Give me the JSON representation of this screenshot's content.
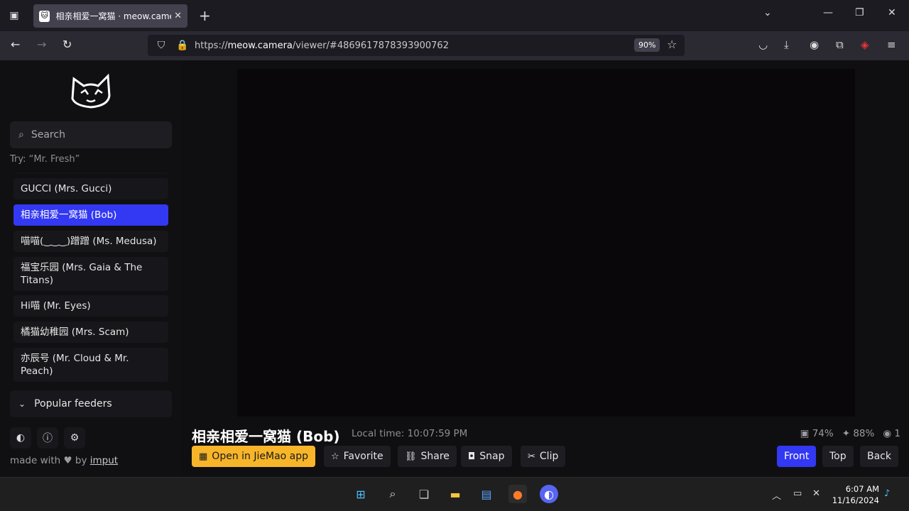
{
  "browser": {
    "tab_title": "相亲相爱一窝猫 · meow.camera",
    "url_prefix": "https://",
    "url_domain": "meow.camera",
    "url_path": "/viewer/#4869617878393900762",
    "zoom": "90%"
  },
  "sidebar": {
    "search_placeholder": "Search",
    "hint": "Try: “Mr. Fresh”",
    "cameras": [
      {
        "label": "GUCCI (Mrs. Gucci)"
      },
      {
        "label": "相亲相爱一窝猫 (Bob)",
        "active": true
      },
      {
        "label": "喵喵(‿‿‿)蹭蹭 (Ms. Medusa)"
      },
      {
        "label": "福宝乐园 (Mrs. Gaia & The Titans)"
      },
      {
        "label": "Hi喵 (Mr. Eyes)"
      },
      {
        "label": "橘猫幼稚园 (Mrs. Scam)"
      },
      {
        "label": "亦辰号 (Mr. Cloud & Mr. Peach)"
      }
    ],
    "popular_label": "Popular feeders",
    "made_with": "made with ♥ by ",
    "made_with_link": "imput"
  },
  "viewer": {
    "title": "相亲相爱一窝猫 (Bob)",
    "local_time": "Local time: 10:07:59 PM",
    "food_level": "74%",
    "battery_level": "88%",
    "viewers": "1",
    "actions": {
      "open_app": "Open in JieMao app",
      "favorite": "Favorite",
      "share": "Share",
      "snap": "Snap",
      "clip": "Clip"
    },
    "views": {
      "front": "Front",
      "top": "Top",
      "back": "Back"
    }
  },
  "taskbar": {
    "time": "6:07 AM",
    "date": "11/16/2024"
  },
  "colors": {
    "accent": "#3338f2",
    "primary_button": "#f7b52a"
  }
}
